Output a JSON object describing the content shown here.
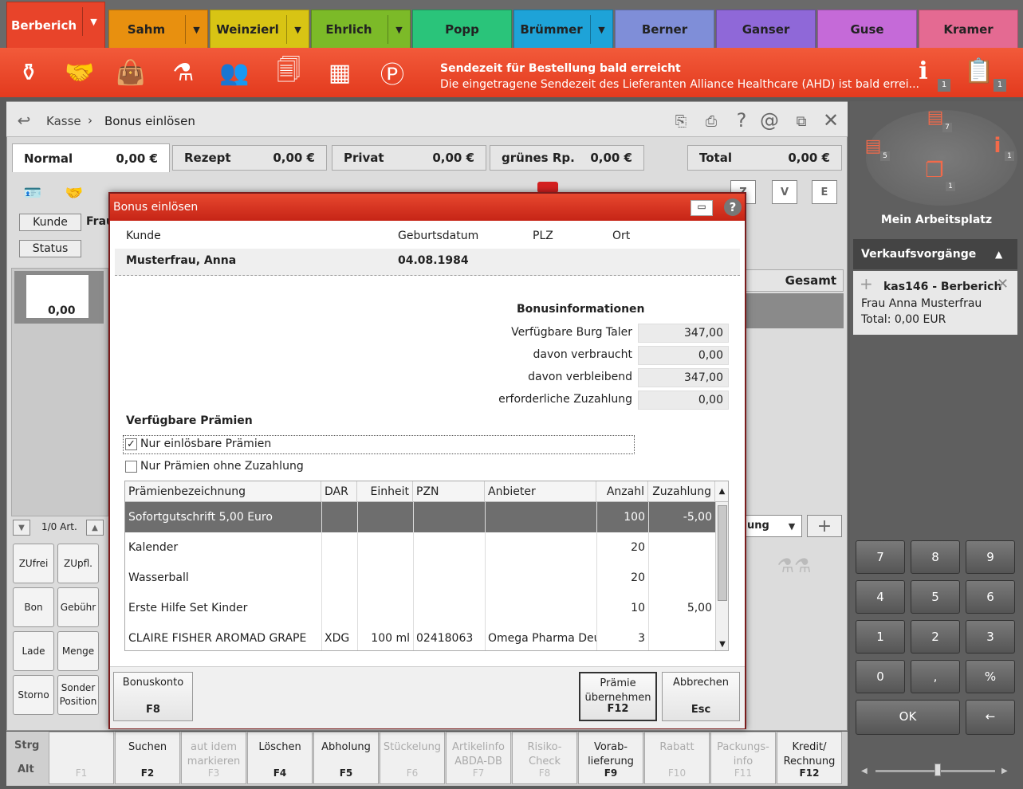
{
  "user_tabs": [
    {
      "label": "Berberich",
      "color": "#e8442a",
      "dropdown": true,
      "active": true
    },
    {
      "label": "Sahm",
      "color": "#e8900f",
      "dropdown": true
    },
    {
      "label": "Weinzierl",
      "color": "#d8c414",
      "dropdown": true
    },
    {
      "label": "Ehrlich",
      "color": "#7cba28",
      "dropdown": true
    },
    {
      "label": "Popp",
      "color": "#2ac47a",
      "dropdown": false
    },
    {
      "label": "Brümmer",
      "color": "#1ea3d8",
      "dropdown": true
    },
    {
      "label": "Berner",
      "color": "#7f8ed8",
      "dropdown": false
    },
    {
      "label": "Ganser",
      "color": "#8f68d8",
      "dropdown": false
    },
    {
      "label": "Guse",
      "color": "#c56ad8",
      "dropdown": false
    },
    {
      "label": "Kramer",
      "color": "#e46a92",
      "dropdown": false
    }
  ],
  "notification": {
    "title": "Sendezeit für Bestellung bald erreicht",
    "text": "Die eingetragene Sendezeit des Lieferanten Alliance Healthcare (AHD) ist bald errei..."
  },
  "header_badges": {
    "info": "1",
    "clipboard": "1"
  },
  "breadcrumb": {
    "root": "Kasse",
    "separator": "›",
    "current": "Bonus einlösen"
  },
  "totals_tabs": [
    {
      "label": "Normal",
      "amount": "0,00 €"
    },
    {
      "label": "Rezept",
      "amount": "0,00 €"
    },
    {
      "label": "Privat",
      "amount": "0,00 €"
    },
    {
      "label": "grünes Rp.",
      "amount": "0,00 €"
    },
    {
      "label": "Total",
      "amount": "0,00 €"
    }
  ],
  "left": {
    "kunde_button": "Kunde",
    "kunde_name": "Frau",
    "status_button": "Status",
    "receipt_value": "0,00",
    "art_count": "1/0 Art.",
    "gesamt": "Gesamt",
    "ung": "ung"
  },
  "zvE": [
    "Z",
    "V",
    "E"
  ],
  "side_buttons": [
    "ZUfrei",
    "ZUpfl.",
    "Bon",
    "Gebühr",
    "Lade",
    "Menge",
    "Storno",
    "Sonder Position"
  ],
  "dialog": {
    "title": "Bonus einlösen",
    "cust_headers": {
      "kunde": "Kunde",
      "geburtsdatum": "Geburtsdatum",
      "plz": "PLZ",
      "ort": "Ort"
    },
    "customer": {
      "name": "Musterfrau, Anna",
      "birth": "04.08.1984",
      "plz": "",
      "ort": ""
    },
    "bonus_title": "Bonusinformationen",
    "bonus": [
      {
        "label": "Verfügbare Burg Taler",
        "value": "347,00"
      },
      {
        "label": "davon verbraucht",
        "value": "0,00"
      },
      {
        "label": "davon verbleibend",
        "value": "347,00"
      },
      {
        "label": "erforderliche Zuzahlung",
        "value": "0,00"
      }
    ],
    "praemien_title": "Verfügbare Prämien",
    "filter1": "Nur einlösbare Prämien",
    "filter2": "Nur Prämien ohne Zuzahlung",
    "columns": [
      "Prämienbezeichnung",
      "DAR",
      "Einheit",
      "PZN",
      "Anbieter",
      "Anzahl",
      "Zuzahlung"
    ],
    "rows": [
      {
        "name": "Sofortgutschrift 5,00 Euro",
        "dar": "",
        "einheit": "",
        "pzn": "",
        "anbieter": "",
        "anzahl": "100",
        "zuzahlung": "-5,00"
      },
      {
        "name": "Kalender",
        "dar": "",
        "einheit": "",
        "pzn": "",
        "anbieter": "",
        "anzahl": "20",
        "zuzahlung": ""
      },
      {
        "name": "Wasserball",
        "dar": "",
        "einheit": "",
        "pzn": "",
        "anbieter": "",
        "anzahl": "20",
        "zuzahlung": ""
      },
      {
        "name": "Erste Hilfe Set Kinder",
        "dar": "",
        "einheit": "",
        "pzn": "",
        "anbieter": "",
        "anzahl": "10",
        "zuzahlung": "5,00"
      },
      {
        "name": "CLAIRE FISHER AROMAD GRAPE",
        "dar": "XDG",
        "einheit": "100 ml",
        "pzn": "02418063",
        "anbieter": "Omega Pharma Deu",
        "anzahl": "3",
        "zuzahlung": ""
      }
    ],
    "btn_bonuskonto": {
      "label": "Bonuskonto",
      "key": "F8"
    },
    "btn_uebernehmen": {
      "label": "Prämie übernehmen",
      "key": "F12"
    },
    "btn_abbrechen": {
      "label": "Abbrechen",
      "key": "Esc"
    }
  },
  "fkeys": {
    "strg": "Strg",
    "alt": "Alt",
    "items": [
      {
        "label": "",
        "key": "F1",
        "enabled": false
      },
      {
        "label": "Suchen",
        "key": "F2",
        "enabled": true
      },
      {
        "label": "aut idem markieren",
        "key": "F3",
        "enabled": false
      },
      {
        "label": "Löschen",
        "key": "F4",
        "enabled": true
      },
      {
        "label": "Abholung",
        "key": "F5",
        "enabled": true
      },
      {
        "label": "Stückelung",
        "key": "F6",
        "enabled": false
      },
      {
        "label": "Artikelinfo ABDA-DB",
        "key": "F7",
        "enabled": false
      },
      {
        "label": "Risiko-Check",
        "key": "F8",
        "enabled": false
      },
      {
        "label": "Vorab-lieferung",
        "key": "F9",
        "enabled": true
      },
      {
        "label": "Rabatt",
        "key": "F10",
        "enabled": false
      },
      {
        "label": "Packungs-info",
        "key": "F11",
        "enabled": false
      },
      {
        "label": "Kredit/ Rechnung",
        "key": "F12",
        "enabled": true
      }
    ]
  },
  "right": {
    "workspace_title": "Mein Arbeitsplatz",
    "badges": [
      "5",
      "7",
      "1",
      "1"
    ],
    "sales_title": "Verkaufsvorgänge",
    "sale": {
      "id": "kas146 - Berberich",
      "customer": "Frau Anna Musterfrau",
      "total": "Total: 0,00 EUR"
    },
    "keypad": [
      "7",
      "8",
      "9",
      "4",
      "5",
      "6",
      "1",
      "2",
      "3",
      "0",
      ",",
      "%",
      "OK",
      "←"
    ]
  }
}
